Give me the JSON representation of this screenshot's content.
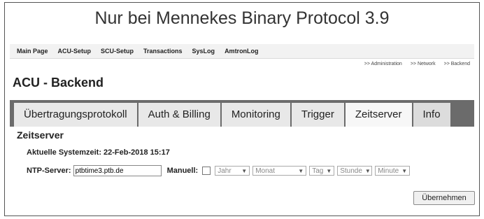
{
  "caption": "Nur bei Mennekes Binary Protocol 3.9",
  "menu": [
    "Main Page",
    "ACU-Setup",
    "SCU-Setup",
    "Transactions",
    "SysLog",
    "AmtronLog"
  ],
  "breadcrumb": [
    ">> Administration",
    ">> Network",
    ">> Backend"
  ],
  "page_title": "ACU - Backend",
  "tabs": [
    "Übertragungsprotokoll",
    "Auth & Billing",
    "Monitoring",
    "Trigger",
    "Zeitserver",
    "Info"
  ],
  "active_tab": "Zeitserver",
  "section_title": "Zeitserver",
  "systemzeit": "Aktuelle Systemzeit: 22-Feb-2018 15:17",
  "ntp": {
    "label": "NTP-Server:",
    "value": "ptbtime3.ptb.de",
    "manual_label": "Manuell:",
    "manual_checked": false
  },
  "selects": [
    "Jahr",
    "Monat",
    "Tag",
    "Stunde",
    "Minute"
  ],
  "submit_label": "Übernehmen"
}
